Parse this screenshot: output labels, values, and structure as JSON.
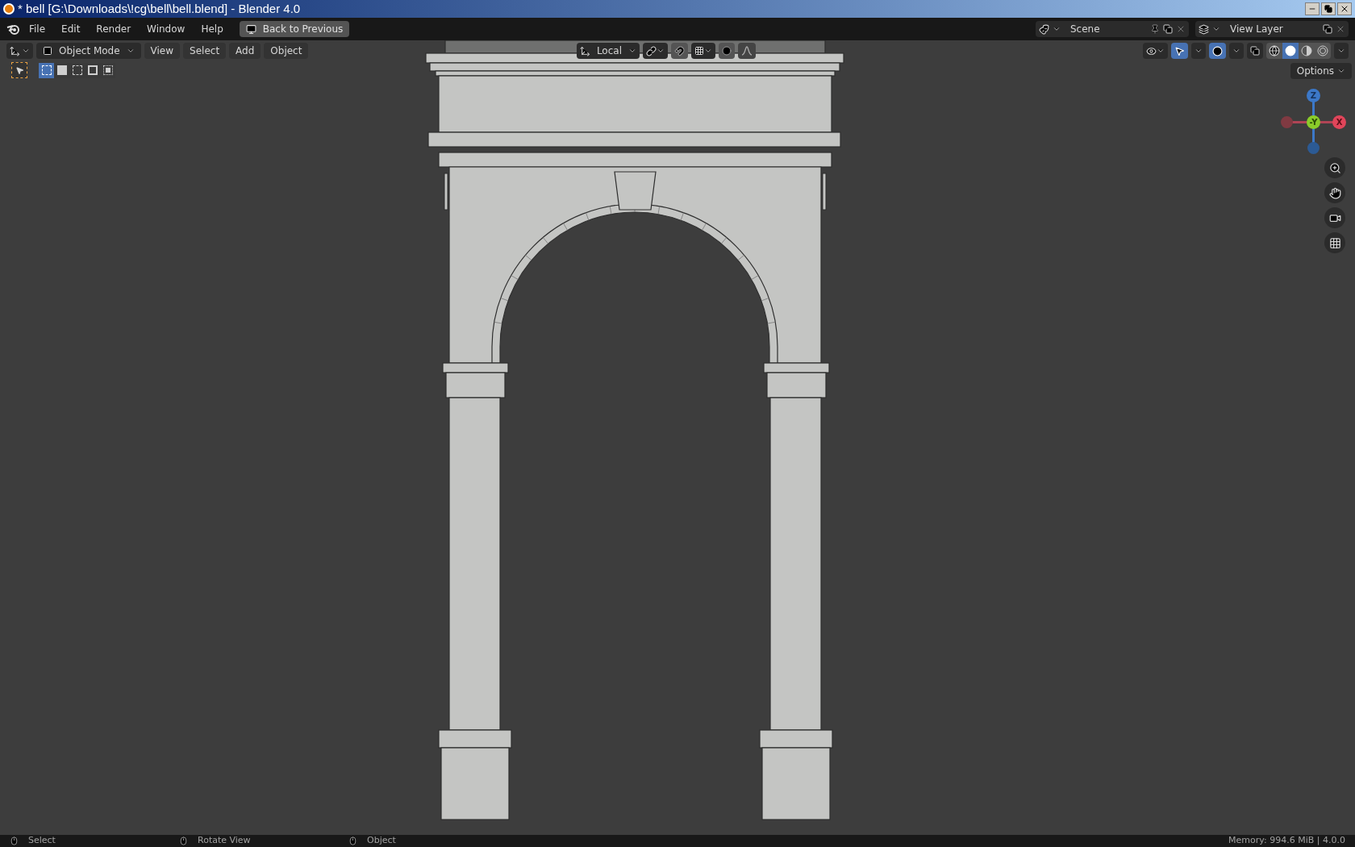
{
  "window": {
    "title": "* bell [G:\\Downloads\\!cg\\bell\\bell.blend] - Blender 4.0"
  },
  "top_bar": {
    "menus": [
      "File",
      "Edit",
      "Render",
      "Window",
      "Help"
    ],
    "back_button": "Back to Previous",
    "scene": "Scene",
    "view_layer": "View Layer"
  },
  "viewport_header": {
    "mode": "Object Mode",
    "menus": [
      "View",
      "Select",
      "Add",
      "Object"
    ],
    "orientation": "Local",
    "snap_on": false,
    "proportional_on": false,
    "gizmos_on": true,
    "overlays_on": true,
    "xray_on": false,
    "shading": [
      {
        "kind": "wireframe",
        "selected": false
      },
      {
        "kind": "solid",
        "selected": true
      },
      {
        "kind": "material",
        "selected": false
      },
      {
        "kind": "rendered",
        "selected": false
      }
    ],
    "select_modes": [
      {
        "kind": "new",
        "selected": true
      },
      {
        "kind": "extend",
        "selected": false
      },
      {
        "kind": "subtract",
        "selected": false
      },
      {
        "kind": "invert",
        "selected": false
      },
      {
        "kind": "intersect",
        "selected": false
      }
    ],
    "options": "Options"
  },
  "gizmo": {
    "z": "Z",
    "y": "-Y",
    "x": "X"
  },
  "status_bar": {
    "items": [
      "Select",
      "Rotate View",
      "Object"
    ],
    "memory": "Memory: 994.6 MiB | 4.0.0"
  }
}
